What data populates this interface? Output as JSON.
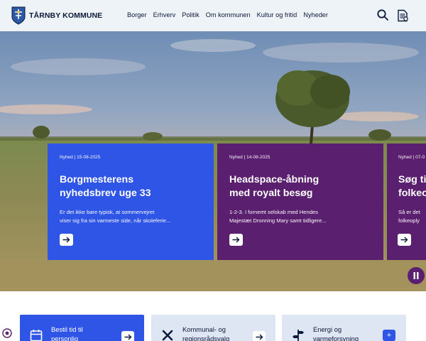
{
  "header": {
    "logo_text": "TÅRNBY KOMMUNE",
    "nav": [
      "Borger",
      "Erhverv",
      "Politik",
      "Om kommunen",
      "Kultur og fritid",
      "Nyheder"
    ],
    "icons": [
      "search-icon",
      "document-list-icon"
    ]
  },
  "hero": {
    "cards": [
      {
        "meta": "Nyhed | 15-08-2025",
        "title_line1": "Borgmesterens",
        "title_line2": "nyhedsbrev uge 33",
        "desc_line1": "Er det ikke bare typisk, at sommervejret",
        "desc_line2": "viser sig fra sin varmeste side, når skoleferie...",
        "color": "#2f55e6"
      },
      {
        "meta": "Nyhed | 14-08-2025",
        "title_line1": "Headspace-åbning",
        "title_line2": "med royalt besøg",
        "desc_line1": "1-2-3. I fornemt selskab med Hendes",
        "desc_line2": "Majestæt Dronning Mary samt tidligere...",
        "color": "#5a1f6e"
      },
      {
        "meta": "Nyhed | 07-0",
        "title_line1": "Søg ti",
        "title_line2": "folkeo",
        "desc_line1": "Så er det",
        "desc_line2": "folkeoply",
        "color": "#5a1f6e"
      }
    ],
    "pause_icon": "pause-icon"
  },
  "tiles": [
    {
      "line1": "Bestil tid til",
      "line2": "personlig",
      "icon": "calendar-icon",
      "button_icon": "arrow-right-icon"
    },
    {
      "line1": "Kommunal- og",
      "line2": "regionsrådsvalg",
      "icon": "vote-cross-icon",
      "button_icon": "arrow-right-icon"
    },
    {
      "line1": "Energi og",
      "line2": "varmeforsyning",
      "icon": "signpost-icon",
      "button_icon": "plus-icon",
      "button_label": "+"
    }
  ],
  "colors": {
    "blue": "#2f55e6",
    "purple": "#5a1f6e",
    "navy": "#0c1a3a",
    "header_bg": "#eef3f8"
  }
}
